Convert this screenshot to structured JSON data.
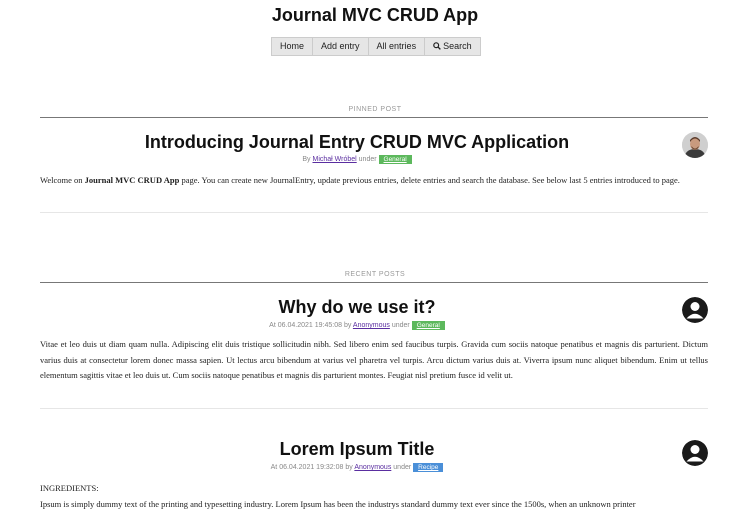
{
  "app": {
    "title": "Journal MVC CRUD App"
  },
  "nav": {
    "home": "Home",
    "add": "Add entry",
    "all": "All entries",
    "search": "Search"
  },
  "pinned": {
    "section_label": "PINNED POST",
    "title": "Introducing Journal Entry CRUD MVC Application",
    "by_prefix": "By",
    "author": "Michał Wróbel",
    "under": "under",
    "category": "General",
    "category_color": "#5cb85c",
    "body_pre": "Welcome on",
    "body_bold": "Journal MVC CRUD App",
    "body_post": "page. You can create new JournalEntry, update previous entries, delete entries and search the database. See below last 5 entries introduced to page."
  },
  "recent": {
    "section_label": "RECENT POSTS",
    "posts": [
      {
        "title": "Why do we use it?",
        "at_prefix": "At",
        "date": "06.04.2021 19:45:08",
        "by_prefix": "by",
        "author": "Anonymous",
        "under": "under",
        "category": "General",
        "category_color": "#5cb85c",
        "body": "Vitae et leo duis ut diam quam nulla. Adipiscing elit duis tristique sollicitudin nibh. Sed libero enim sed faucibus turpis. Gravida cum sociis natoque penatibus et magnis dis parturient. Dictum varius duis at consectetur lorem donec massa sapien. Ut lectus arcu bibendum at varius vel pharetra vel turpis. Arcu dictum varius duis at. Viverra ipsum nunc aliquet bibendum. Enim ut tellus elementum sagittis vitae et leo duis ut. Cum sociis natoque penatibus et magnis dis parturient montes. Feugiat nisl pretium fusce id velit ut."
      },
      {
        "title": "Lorem Ipsum Title",
        "at_prefix": "At",
        "date": "06.04.2021 19:32:08",
        "by_prefix": "by",
        "author": "Anonymous",
        "under": "under",
        "category": "Recipe",
        "category_color": "#4a8fd8",
        "body_line1": "INGREDIENTS:",
        "body_line2": "Ipsum is simply dummy text of the printing and typesetting industry. Lorem Ipsum has been the industrys standard dummy text ever since the 1500s, when an unknown printer"
      }
    ]
  }
}
